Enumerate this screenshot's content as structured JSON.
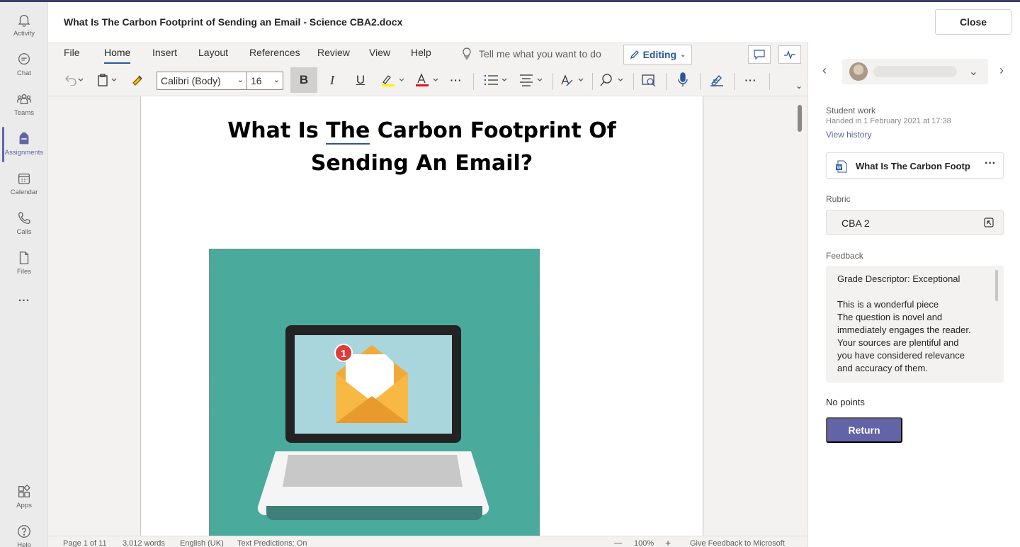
{
  "app": {
    "rail": [
      {
        "label": "Activity",
        "icon": "bell-icon"
      },
      {
        "label": "Chat",
        "icon": "chat-icon"
      },
      {
        "label": "Teams",
        "icon": "teams-icon"
      },
      {
        "label": "Assignments",
        "icon": "assignments-icon",
        "active": true
      },
      {
        "label": "Calendar",
        "icon": "calendar-icon"
      },
      {
        "label": "Calls",
        "icon": "phone-icon"
      },
      {
        "label": "Files",
        "icon": "file-icon"
      },
      {
        "label": "...",
        "icon": "more-icon"
      }
    ],
    "rail_bottom": [
      {
        "label": "Apps",
        "icon": "apps-icon"
      },
      {
        "label": "Help",
        "icon": "help-icon"
      }
    ],
    "accent": "#6264a7"
  },
  "header": {
    "title": "What Is The Carbon Footprint of Sending an Email - Science CBA2.docx",
    "close_label": "Close"
  },
  "ribbon": {
    "tabs": [
      "File",
      "Home",
      "Insert",
      "Layout",
      "References",
      "Review",
      "View",
      "Help"
    ],
    "active_tab": "Home",
    "tell_me": "Tell me what you want to do",
    "mode_label": "Editing",
    "font_name": "Calibri (Body)",
    "font_size": "16",
    "bold": "B",
    "italic": "I",
    "underline": "U",
    "more": "···"
  },
  "document": {
    "title_line1_a": "What Is ",
    "title_line1_b": "The",
    "title_line1_c": " Carbon Footprint Of",
    "title_line2": "Sending An Email?",
    "figure_badge": "1"
  },
  "status_bar": {
    "page": "Page 1 of 11",
    "words": "3,012 words",
    "language": "English (UK)",
    "predictions": "Text Predictions: On",
    "zoom_minus": "—",
    "zoom": "100%",
    "zoom_plus": "+",
    "feedback": "Give Feedback to Microsoft"
  },
  "pane": {
    "student_work_label": "Student work",
    "handed_in": "Handed in 1 February 2021 at 17:38",
    "view_history": "View history",
    "file_name": "What Is The Carbon Footp",
    "file_more": "···",
    "rubric_label": "Rubric",
    "rubric_value": "CBA 2",
    "feedback_label": "Feedback",
    "feedback_lines": [
      "Grade Descriptor: Exceptional",
      "",
      "This is a wonderful piece",
      "The question is novel and",
      "immediately engages the reader.",
      "Your sources are plentiful and",
      "you have considered relevance",
      "and accuracy of them."
    ],
    "points": "No points",
    "return_label": "Return"
  }
}
